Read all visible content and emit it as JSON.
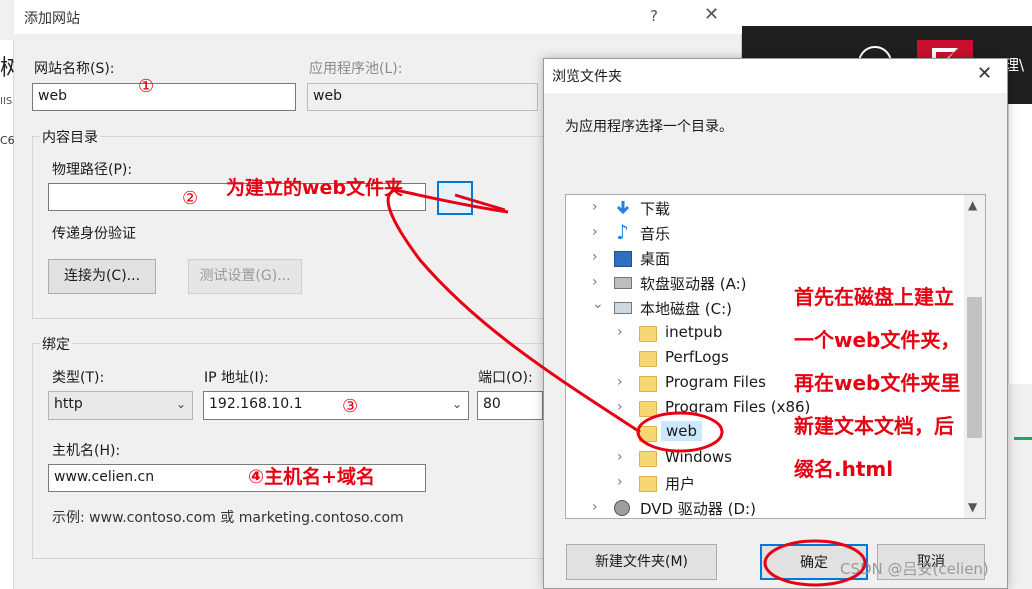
{
  "background_window": {
    "header_text": "理\\",
    "left_glyph": "树",
    "left_iis": "IIS",
    "left_c6": "C6"
  },
  "add_site_dialog": {
    "title": "添加网站",
    "help": "?",
    "close": "✕",
    "site_name_label": "网站名称(S):",
    "site_name_value": "web",
    "app_pool_label": "应用程序池(L):",
    "app_pool_value": "web",
    "content_dir_label": "内容目录",
    "physical_path_label": "物理路径(P):",
    "physical_path_value": "",
    "pass_through_auth_label": "传递身份验证",
    "connect_as_label": "连接为(C)...",
    "test_settings_label": "测试设置(G)...",
    "binding_label": "绑定",
    "type_label": "类型(T):",
    "type_value": "http",
    "ip_label": "IP 地址(I):",
    "ip_value": "192.168.10.1",
    "port_label": "端口(O):",
    "port_value": "80",
    "hostname_label": "主机名(H):",
    "hostname_value": "www.celien.cn",
    "example_text": "示例: www.contoso.com 或 marketing.contoso.com"
  },
  "browse_dialog": {
    "title": "浏览文件夹",
    "close": "✕",
    "prompt": "为应用程序选择一个目录。",
    "tree": [
      {
        "label": "下载",
        "icon": "download-icon",
        "expander": "›"
      },
      {
        "label": "音乐",
        "icon": "music-icon",
        "expander": "›"
      },
      {
        "label": "桌面",
        "icon": "desktop-icon",
        "expander": "›"
      },
      {
        "label": "软盘驱动器 (A:)",
        "icon": "floppy-icon",
        "expander": "›"
      },
      {
        "label": "本地磁盘 (C:)",
        "icon": "disk-icon",
        "expander": "⌄"
      },
      {
        "label": "inetpub",
        "icon": "folder-icon",
        "expander": "›"
      },
      {
        "label": "PerfLogs",
        "icon": "folder-icon",
        "expander": ""
      },
      {
        "label": "Program Files",
        "icon": "folder-icon",
        "expander": "›"
      },
      {
        "label": "Program Files (x86)",
        "icon": "folder-icon",
        "expander": "›"
      },
      {
        "label": "web",
        "icon": "folder-icon",
        "expander": ""
      },
      {
        "label": "Windows",
        "icon": "folder-icon",
        "expander": "›"
      },
      {
        "label": "用户",
        "icon": "folder-icon",
        "expander": "›"
      },
      {
        "label": "DVD 驱动器 (D:)",
        "icon": "dvd-icon",
        "expander": "›"
      }
    ],
    "new_folder_label": "新建文件夹(M)",
    "ok_label": "确定",
    "cancel_label": "取消"
  },
  "annotations": {
    "circle_1": "①",
    "circle_2": "②",
    "circle_3": "③",
    "note_2": "为建立的web文件夹",
    "note_4": "④主机名+域名",
    "side_note_lines": [
      "首先在磁盘上建立",
      "一个web文件夹，",
      "再在web文件夹里",
      "新建文本文档，后",
      "缀名.html"
    ]
  },
  "watermark": "CSDN @吕安(celien)",
  "colors": {
    "annotation_red": "#e60012",
    "dialog_bg": "#f0f0f0",
    "accent_blue": "#0078d7"
  }
}
